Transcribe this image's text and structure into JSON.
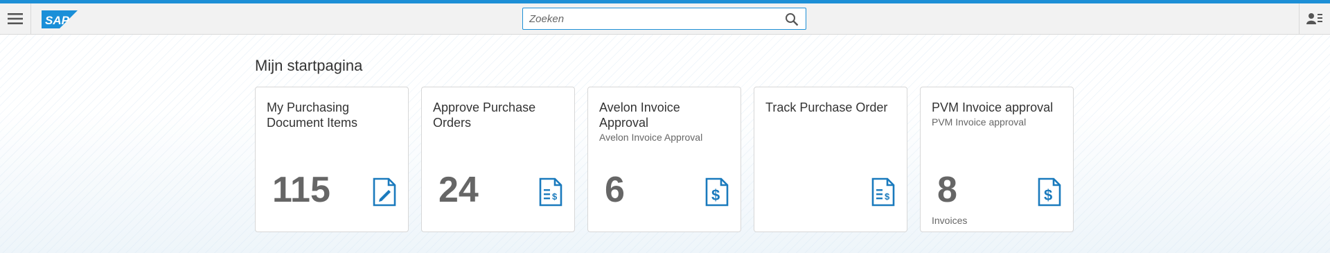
{
  "brand": {
    "logo_text": "SAP",
    "accent": "#1d8fd6",
    "logo_color": "#1a8fd8"
  },
  "header": {
    "menu_icon": "hamburger-icon",
    "search_placeholder": "Zoeken",
    "search_icon": "search-icon",
    "user_icon": "user-menu-icon"
  },
  "page": {
    "title": "Mijn startpagina"
  },
  "tiles": [
    {
      "title": "My Purchasing Document Items",
      "subtitle": "",
      "number": "115",
      "unit": "",
      "icon": "edit-document-icon"
    },
    {
      "title": "Approve Purchase Orders",
      "subtitle": "",
      "number": "24",
      "unit": "",
      "icon": "document-dollar-icon"
    },
    {
      "title": "Avelon Invoice Approval",
      "subtitle": "Avelon Invoice Approval",
      "number": "6",
      "unit": "",
      "icon": "invoice-dollar-icon"
    },
    {
      "title": "Track Purchase Order",
      "subtitle": "",
      "number": "",
      "unit": "",
      "icon": "document-dollar-icon"
    },
    {
      "title": "PVM Invoice approval",
      "subtitle": "PVM Invoice approval",
      "number": "8",
      "unit": "Invoices",
      "icon": "invoice-dollar-icon"
    }
  ]
}
